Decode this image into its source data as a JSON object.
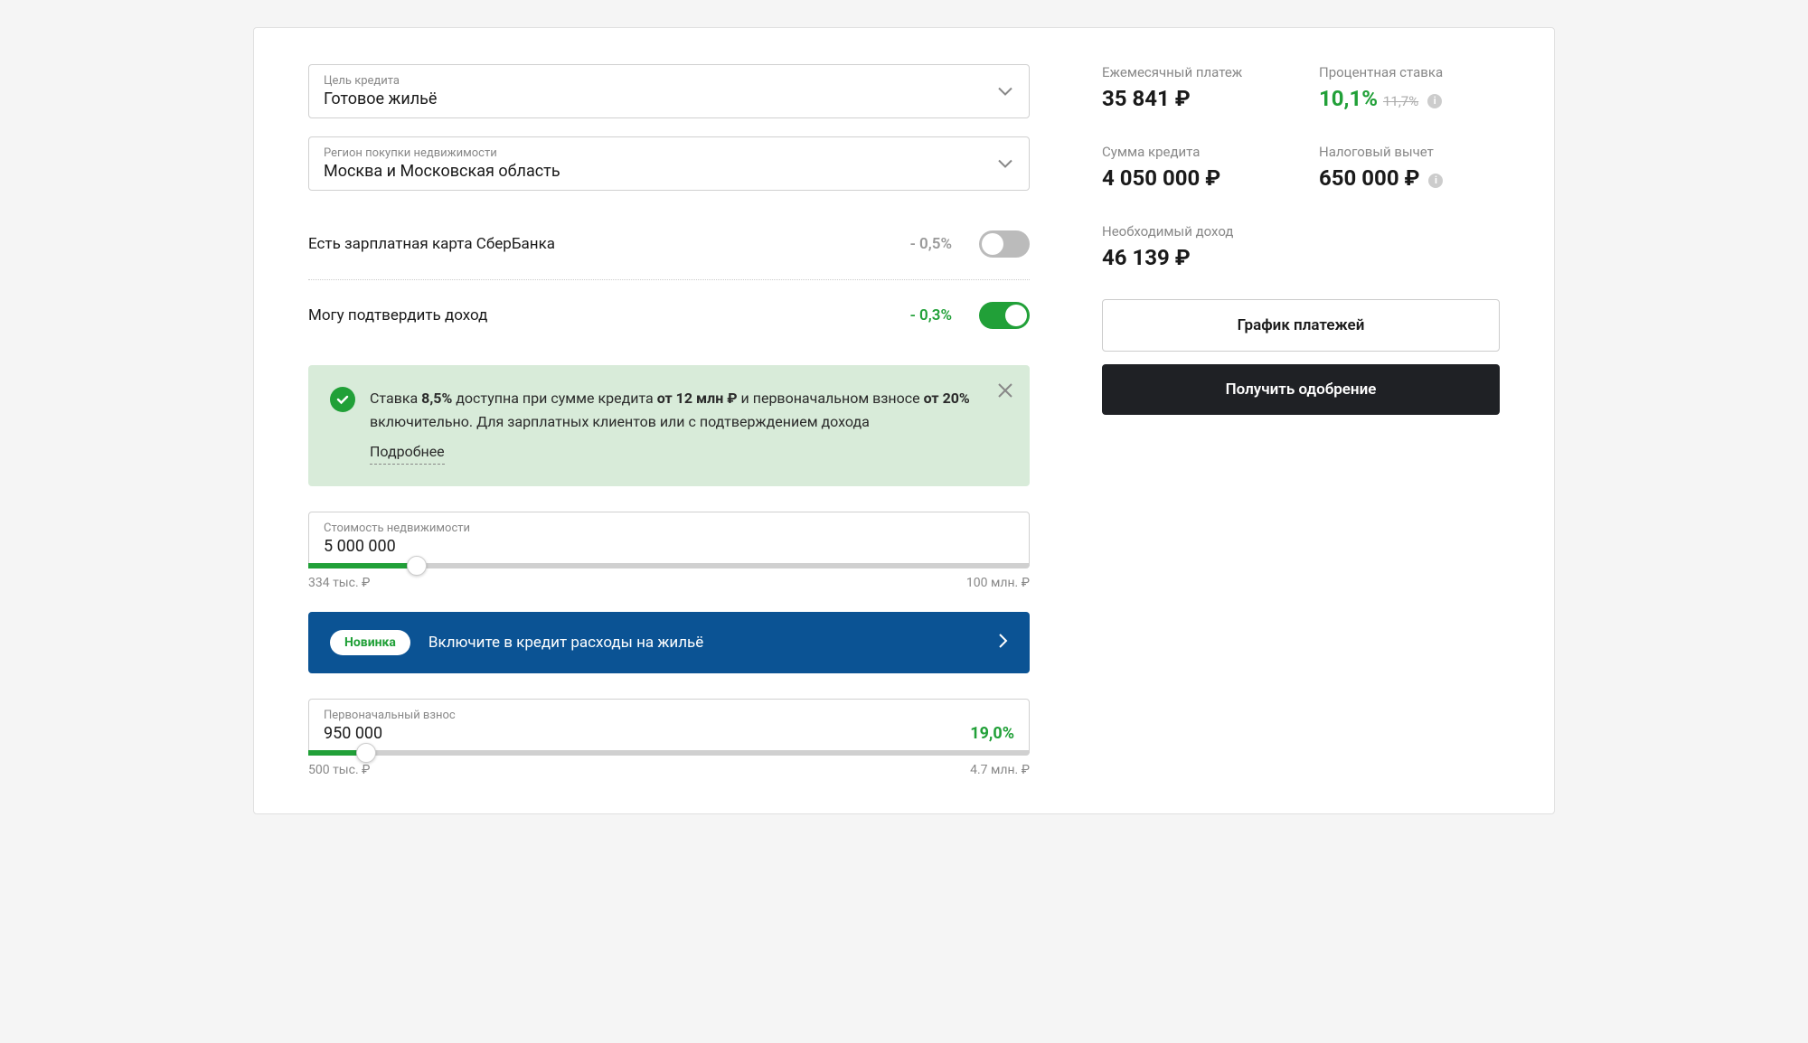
{
  "purpose": {
    "label": "Цель кредита",
    "value": "Готовое жильё"
  },
  "region": {
    "label": "Регион покупки недвижимости",
    "value": "Москва и Московская область"
  },
  "toggle1": {
    "label": "Есть зарплатная карта СберБанка",
    "discount": "- 0,5%",
    "on": false
  },
  "toggle2": {
    "label": "Могу подтвердить доход",
    "discount": "- 0,3%",
    "on": true
  },
  "banner": {
    "t1": "Ставка ",
    "b1": "8,5%",
    "t2": " доступна при сумме кредита ",
    "b2": "от 12 млн ₽",
    "t3": " и первоначальном взносе ",
    "b3": "от 20%",
    "t4": " включительно. Для зарплатных клиентов или с подтверждением дохода",
    "link": "Подробнее"
  },
  "price": {
    "label": "Стоимость недвижимости",
    "value": "5 000 000",
    "min": "334 тыс. ₽",
    "max": "100 млн. ₽",
    "fillPct": 15
  },
  "promo": {
    "badge": "Новинка",
    "text": "Включите в кредит расходы на жильё"
  },
  "down": {
    "label": "Первоначальный взнос",
    "value": "950 000",
    "pct": "19,0%",
    "min": "500 тыс. ₽",
    "max": "4.7 млн. ₽",
    "fillPct": 8
  },
  "summary": {
    "monthly": {
      "label": "Ежемесячный платеж",
      "value": "35 841 ₽"
    },
    "rate": {
      "label": "Процентная ставка",
      "value": "10,1%",
      "old": "11,7%"
    },
    "amount": {
      "label": "Сумма кредита",
      "value": "4 050 000 ₽"
    },
    "tax": {
      "label": "Налоговый вычет",
      "value": "650 000 ₽"
    },
    "income": {
      "label": "Необходимый доход",
      "value": "46 139 ₽"
    }
  },
  "btnSchedule": "График платежей",
  "btnApprove": "Получить одобрение"
}
